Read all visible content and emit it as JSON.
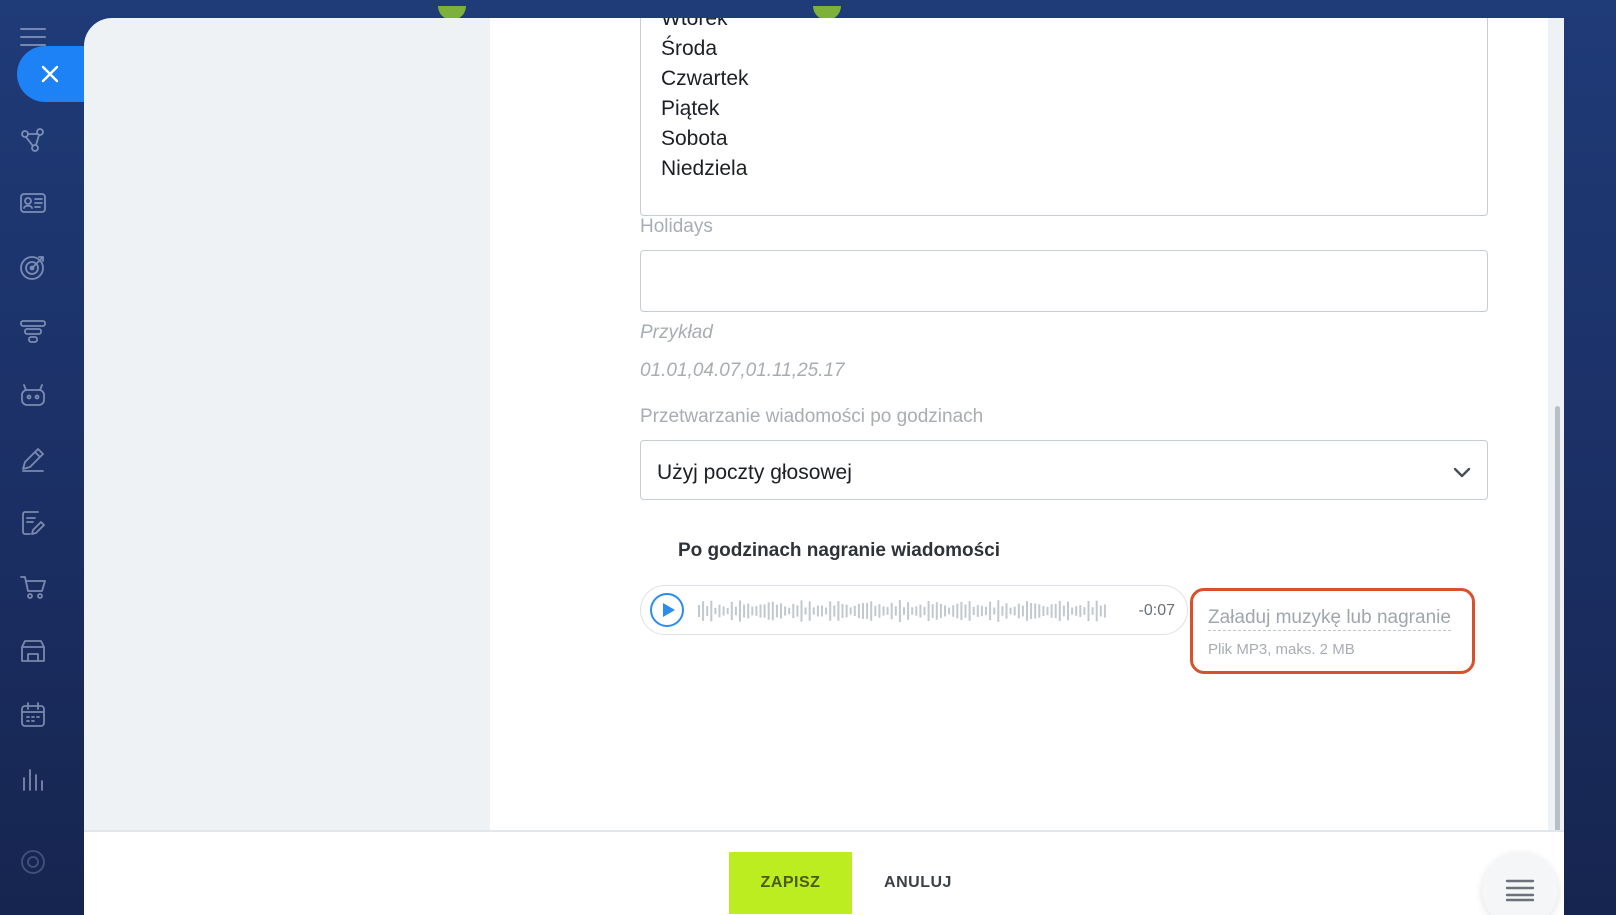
{
  "days": {
    "items": [
      "Wtorek",
      "Środa",
      "Czwartek",
      "Piątek",
      "Sobota",
      "Niedziela"
    ]
  },
  "holidays": {
    "label": "Holidays",
    "value": "",
    "example_label": "Przykład",
    "example_value": "01.01,04.07,01.11,25.17"
  },
  "after_hours": {
    "label": "Przetwarzanie wiadomości po godzinach",
    "selected": "Użyj poczty głosowej"
  },
  "recording": {
    "title": "Po godzinach nagranie wiadomości",
    "time": "-0:07",
    "upload_label": "Załaduj muzykę lub nagranie",
    "upload_note": "Plik MP3, maks. 2 MB"
  },
  "footer": {
    "save_label": "ZAPISZ",
    "cancel_label": "ANULUJ"
  },
  "colors": {
    "save": "#bbed21",
    "accent": "#1d82f5",
    "highlight": "#d9512a"
  },
  "sidebar": {
    "icons": [
      "menu-icon",
      "close-icon",
      "connections-icon",
      "contact-card-icon",
      "target-icon",
      "filter-icon",
      "robot-icon",
      "edit-icon",
      "document-edit-icon",
      "cart-icon",
      "store-icon",
      "calendar-icon",
      "analytics-icon",
      "settings-icon"
    ]
  }
}
